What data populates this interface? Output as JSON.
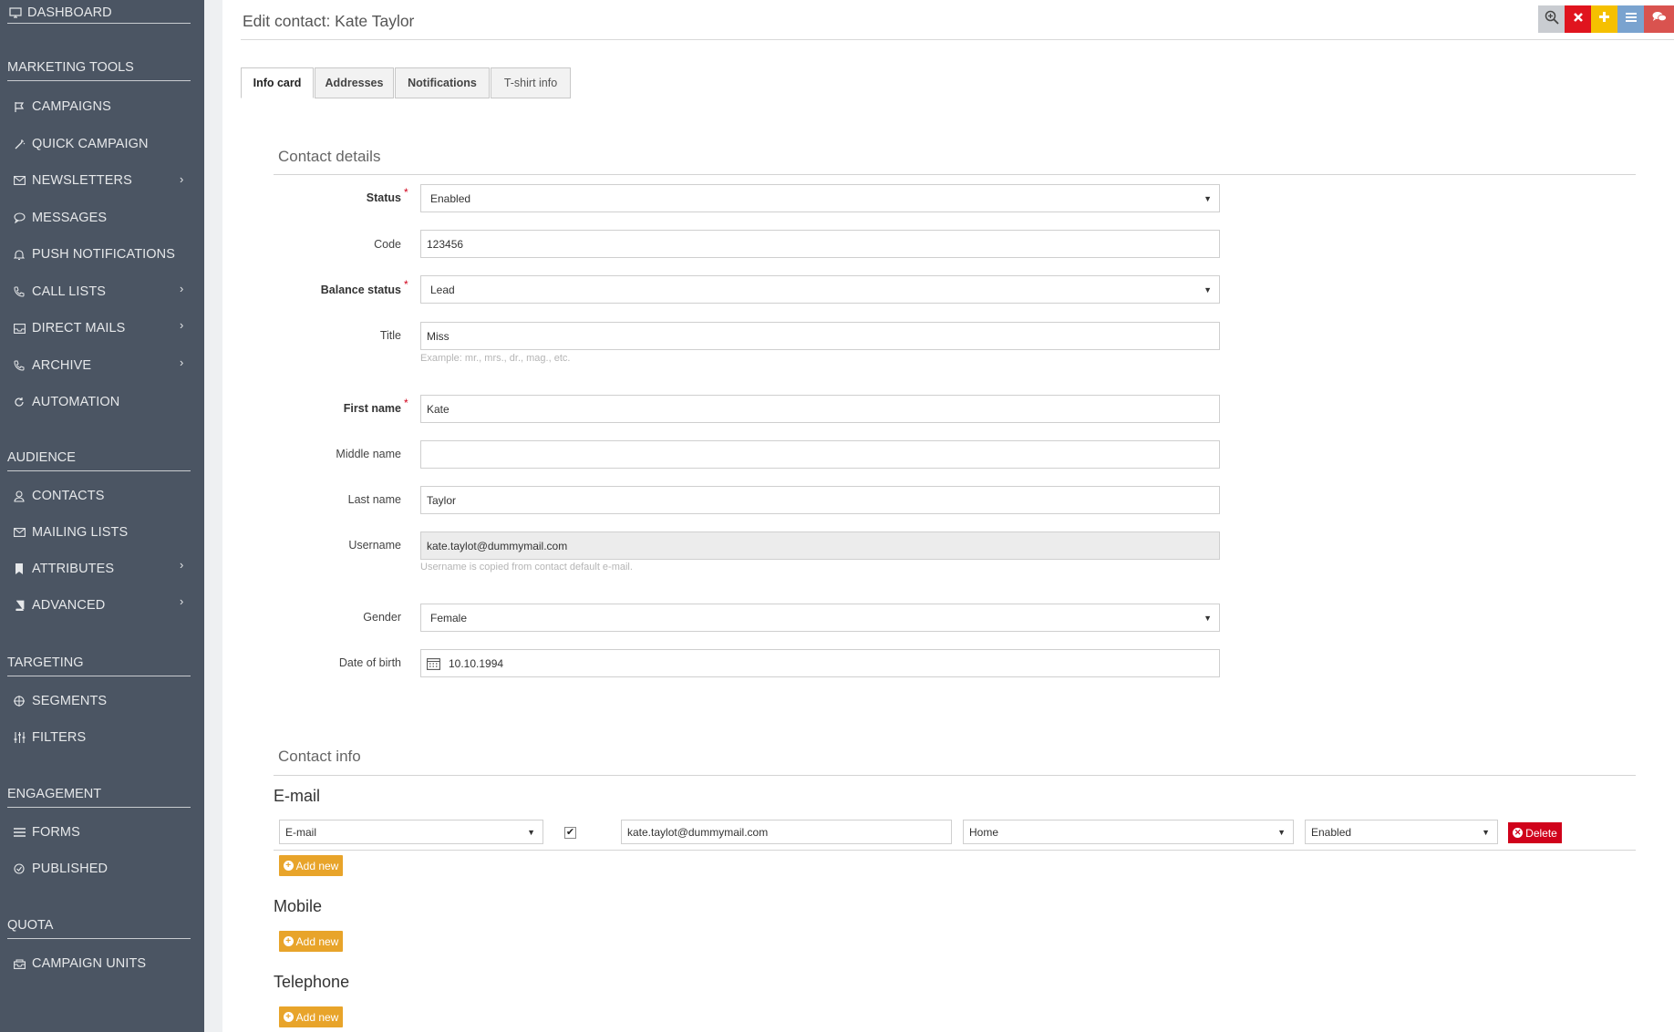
{
  "sidebar": {
    "dashboard": "DASHBOARD",
    "sections": [
      {
        "title": "MARKETING TOOLS"
      },
      {
        "title": "AUDIENCE"
      },
      {
        "title": "TARGETING"
      },
      {
        "title": "ENGAGEMENT"
      },
      {
        "title": "QUOTA"
      }
    ],
    "items": {
      "campaigns": "CAMPAIGNS",
      "quick_campaign": "QUICK CAMPAIGN",
      "newsletters": "NEWSLETTERS",
      "messages": "MESSAGES",
      "push_notifications": "PUSH NOTIFICATIONS",
      "call_lists": "CALL LISTS",
      "direct_mails": "DIRECT MAILS",
      "archive": "ARCHIVE",
      "automation": "AUTOMATION",
      "contacts": "CONTACTS",
      "mailing_lists": "MAILING LISTS",
      "attributes": "ATTRIBUTES",
      "advanced": "ADVANCED",
      "segments": "SEGMENTS",
      "filters": "FILTERS",
      "forms": "FORMS",
      "published": "PUBLISHED",
      "campaign_units": "CAMPAIGN UNITS"
    },
    "chevron": "›"
  },
  "header": {
    "title": "Edit contact: Kate Taylor",
    "toolbar_colors": {
      "search": "#c9ccd1",
      "close": "#e0141e",
      "add": "#f5c000",
      "menu": "#7aa3cf",
      "chat": "#d9534f"
    }
  },
  "tabs": [
    "Info card",
    "Addresses",
    "Notifications",
    "T-shirt info"
  ],
  "contact_details": {
    "title": "Contact details",
    "status": {
      "label": "Status",
      "value": "Enabled"
    },
    "code": {
      "label": "Code",
      "value": "123456"
    },
    "balance_status": {
      "label": "Balance status",
      "value": "Lead"
    },
    "title_field": {
      "label": "Title",
      "value": "Miss",
      "help": "Example: mr., mrs., dr., mag., etc."
    },
    "first_name": {
      "label": "First name",
      "value": "Kate"
    },
    "middle_name": {
      "label": "Middle name",
      "value": ""
    },
    "last_name": {
      "label": "Last name",
      "value": "Taylor"
    },
    "username": {
      "label": "Username",
      "value": "kate.taylot@dummymail.com",
      "help": "Username is copied from contact default e-mail."
    },
    "gender": {
      "label": "Gender",
      "value": "Female"
    },
    "date_of_birth": {
      "label": "Date of birth",
      "value": "10.10.1994"
    },
    "required_mark": "*"
  },
  "contact_info": {
    "title": "Contact info",
    "email": {
      "heading": "E-mail",
      "type": "E-mail",
      "checked": true,
      "address": "kate.taylot@dummymail.com",
      "location": "Home",
      "status": "Enabled",
      "delete_label": "Delete"
    },
    "mobile": {
      "heading": "Mobile"
    },
    "telephone": {
      "heading": "Telephone"
    },
    "add_new_label": "Add new"
  }
}
